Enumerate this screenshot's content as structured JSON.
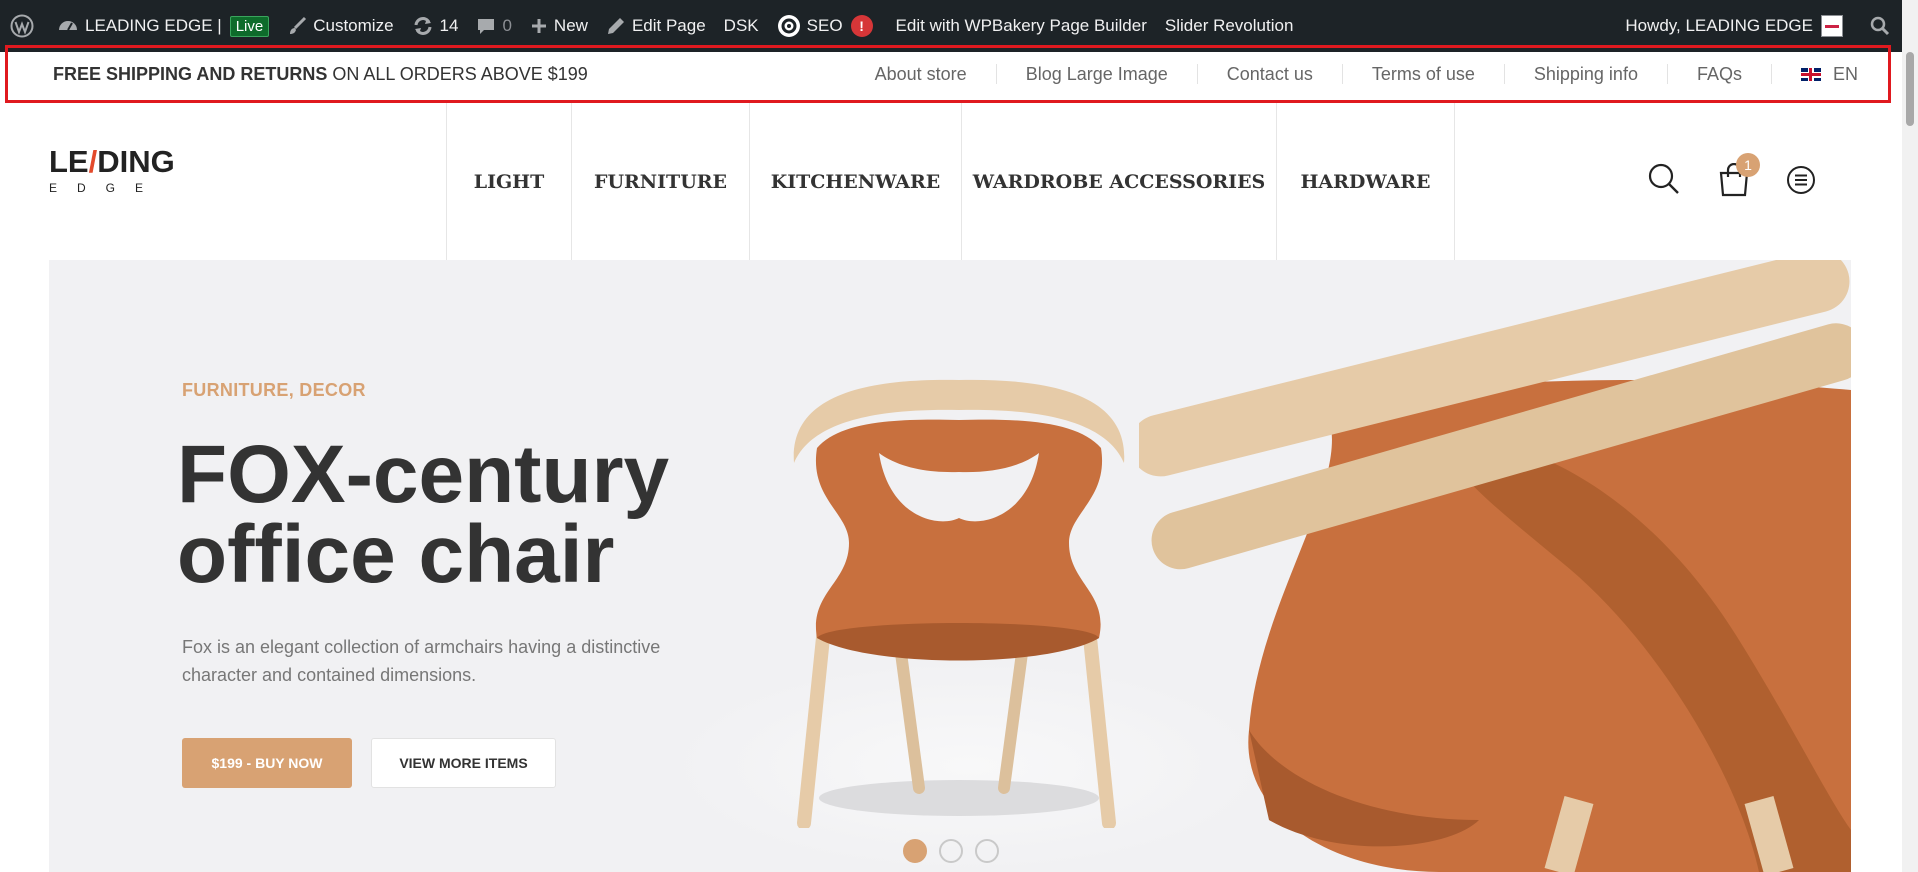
{
  "adminbar": {
    "site_name": "LEADING EDGE |",
    "live_badge": "Live",
    "customize": "Customize",
    "updates_count": "14",
    "comments_count": "0",
    "new": "New",
    "edit_page": "Edit Page",
    "dsk": "DSK",
    "seo": "SEO",
    "seo_badge": "!",
    "wpbakery": "Edit with WPBakery Page Builder",
    "slider_revolution": "Slider Revolution",
    "howdy": "Howdy, LEADING EDGE"
  },
  "topbar": {
    "promo_bold": "FREE SHIPPING AND RETURNS",
    "promo_rest": " ON ALL ORDERS ABOVE $199",
    "links": [
      "About store",
      "Blog Large Image",
      "Contact us",
      "Terms of use",
      "Shipping info",
      "FAQs"
    ],
    "language": "EN"
  },
  "header": {
    "logo_top_a": "LE",
    "logo_top_accent": "/",
    "logo_top_b": "DING",
    "logo_bottom": "EDGE",
    "nav": [
      "LIGHT",
      "FURNITURE",
      "KITCHENWARE",
      "WARDROBE ACCESSORIES",
      "HARDWARE"
    ],
    "cart_count": "1"
  },
  "hero": {
    "category": "FURNITURE, DECOR",
    "title_line1": "FOX-century",
    "title_line2": "office chair",
    "description": "Fox is an elegant collection of armchairs having a distinctive character and contained dimensions.",
    "buy_button": "$199 - BUY NOW",
    "more_button": "VIEW MORE ITEMS",
    "slides_total": 3,
    "active_slide": 1
  },
  "colors": {
    "accent": "#d8a273",
    "adminbar": "#1d2327",
    "highlight_border": "#e0191f",
    "leather": "#c8703e",
    "wood": "#e6cba8"
  },
  "icons": [
    "wordpress-icon",
    "dashboard-icon",
    "brush-icon",
    "updates-icon",
    "comment-icon",
    "plus-icon",
    "pencil-icon",
    "seo-gear-icon",
    "search-icon",
    "uk-flag-icon",
    "cart-icon",
    "menu-icon"
  ]
}
